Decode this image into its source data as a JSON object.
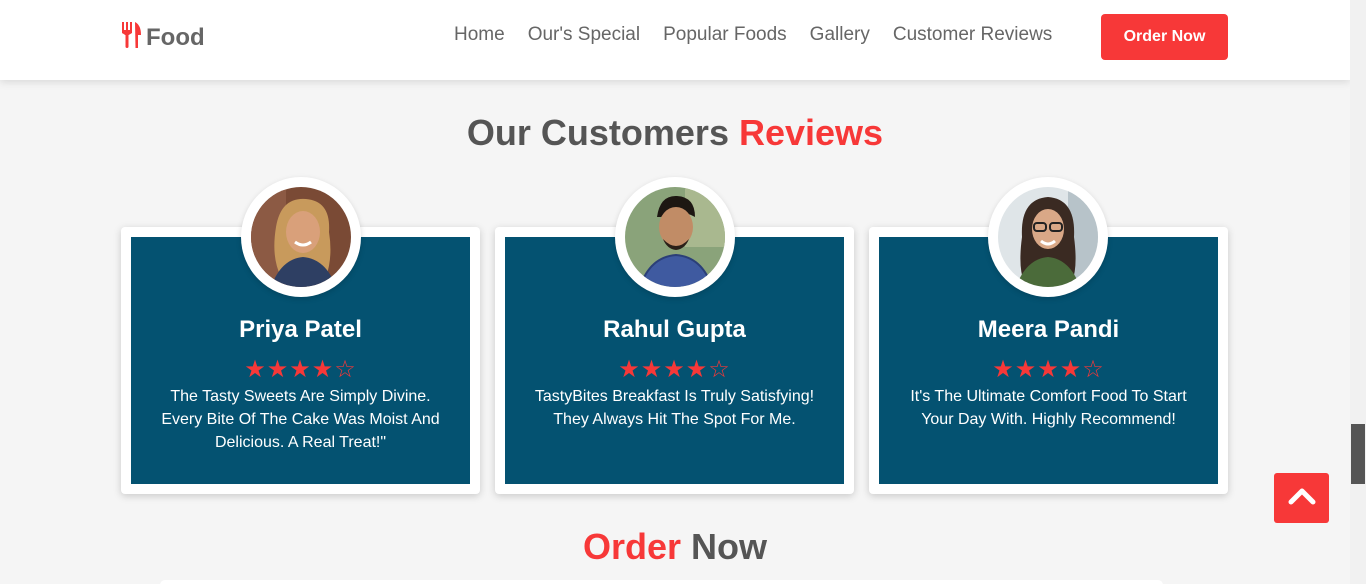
{
  "brand": {
    "name": "Food",
    "icon": "utensils-icon"
  },
  "nav": {
    "items": [
      "Home",
      "Our's Special",
      "Popular Foods",
      "Gallery",
      "Customer Reviews"
    ],
    "order_button": "Order Now"
  },
  "reviews_section": {
    "title_part1": "Our Customers",
    "title_part2": "Reviews"
  },
  "reviews": [
    {
      "name": "Priya Patel",
      "stars": "★★★★☆",
      "rating": 4,
      "text": "The Tasty Sweets Are Simply Divine. Every Bite Of The Cake Was Moist And Delicious. A Real Treat!\""
    },
    {
      "name": "Rahul Gupta",
      "stars": "★★★★☆",
      "rating": 4,
      "text": "TastyBites Breakfast Is Truly Satisfying! They Always Hit The Spot For Me."
    },
    {
      "name": "Meera Pandi",
      "stars": "★★★★☆",
      "rating": 4,
      "text": "It's The Ultimate Comfort Food To Start Your Day With. Highly Recommend!"
    }
  ],
  "order_section": {
    "title_part1": "Order",
    "title_part2": "Now"
  },
  "colors": {
    "accent": "#f73838",
    "card_blue": "#045271",
    "heading_gray": "#555555"
  },
  "icons": {
    "scroll_top": "chevron-up-icon"
  }
}
